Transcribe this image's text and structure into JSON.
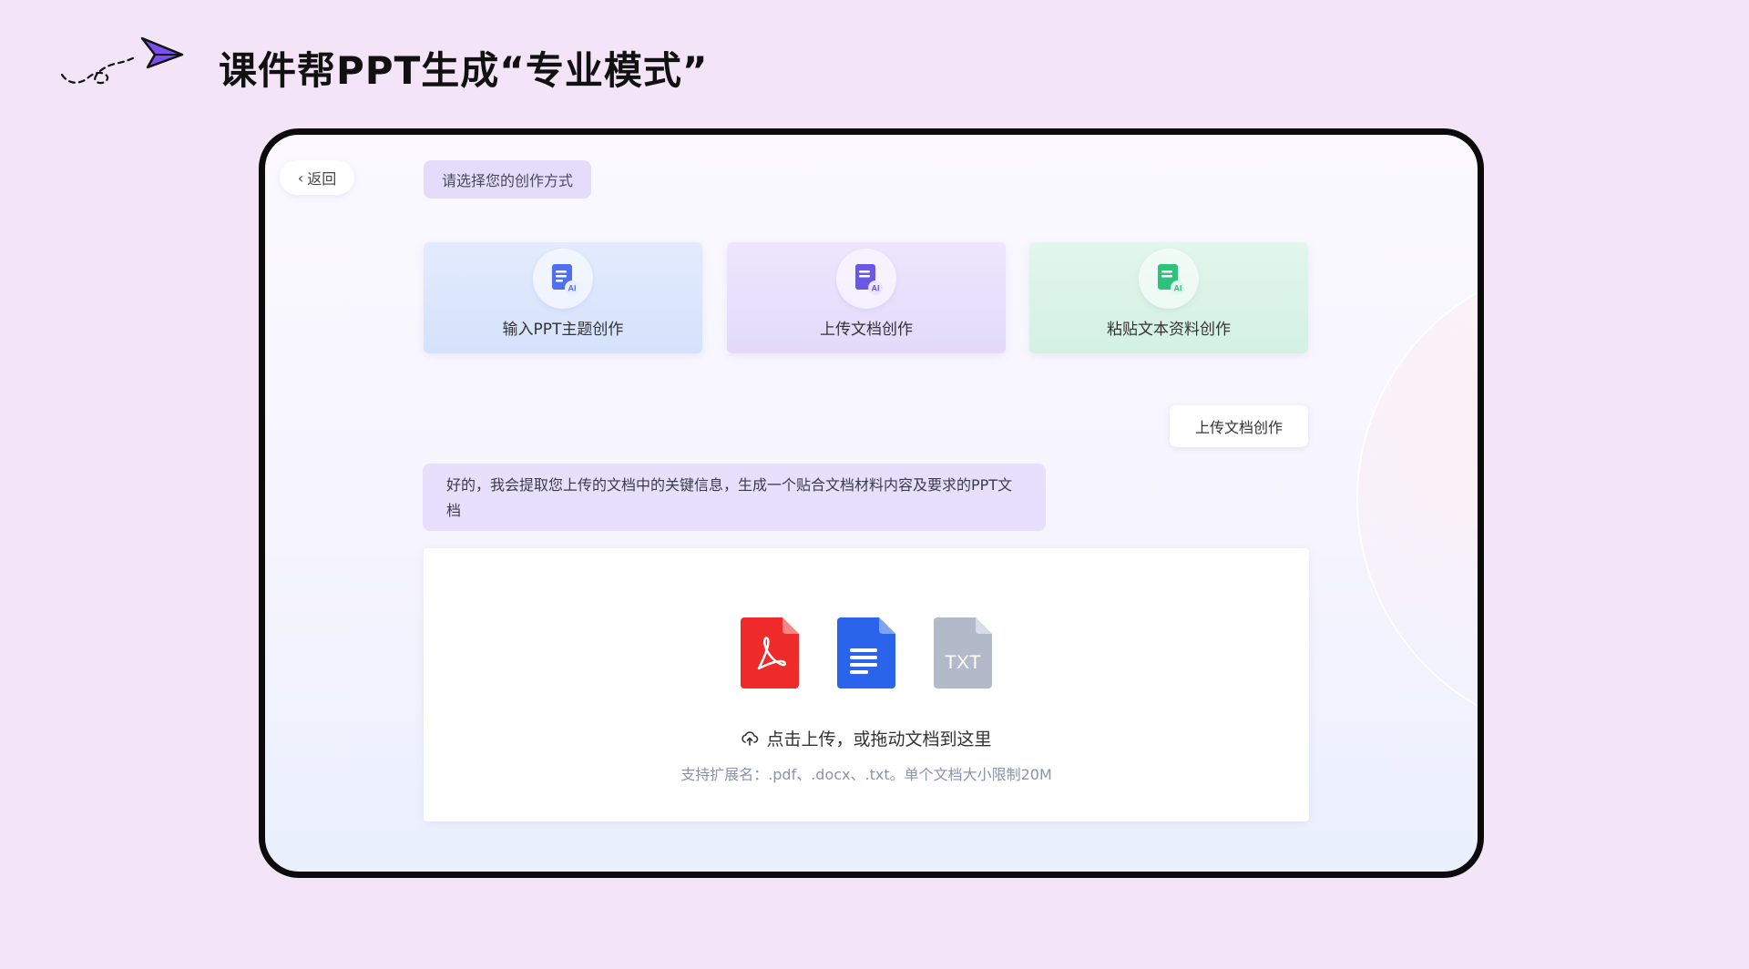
{
  "slide": {
    "title": "课件帮PPT生成“专业模式”"
  },
  "app": {
    "back_label": "返回",
    "prompt": "请选择您的创作方式",
    "modes": [
      {
        "label": "输入PPT主题创作",
        "icon": "doc-ai-icon",
        "accent": "#4f6ef0"
      },
      {
        "label": "上传文档创作",
        "icon": "doc-ai-icon",
        "accent": "#6a56e8"
      },
      {
        "label": "粘贴文本资料创作",
        "icon": "doc-ai-icon",
        "accent": "#2fc27c"
      }
    ],
    "user_message": "上传文档创作",
    "bot_message": "好的，我会提取您上传的文档中的关键信息，生成一个贴合文档材料内容及要求的PPT文档",
    "upload": {
      "file_types": [
        {
          "name": "pdf-file-icon",
          "color": "#ee2a2a"
        },
        {
          "name": "doc-file-icon",
          "color": "#2a64ea"
        },
        {
          "name": "txt-file-icon",
          "color": "#b2b9c8",
          "label": "TXT"
        }
      ],
      "instruction": "点击上传，或拖动文档到这里",
      "support": "支持扩展名：.pdf、.docx、.txt。单个文档大小限制20M"
    }
  }
}
